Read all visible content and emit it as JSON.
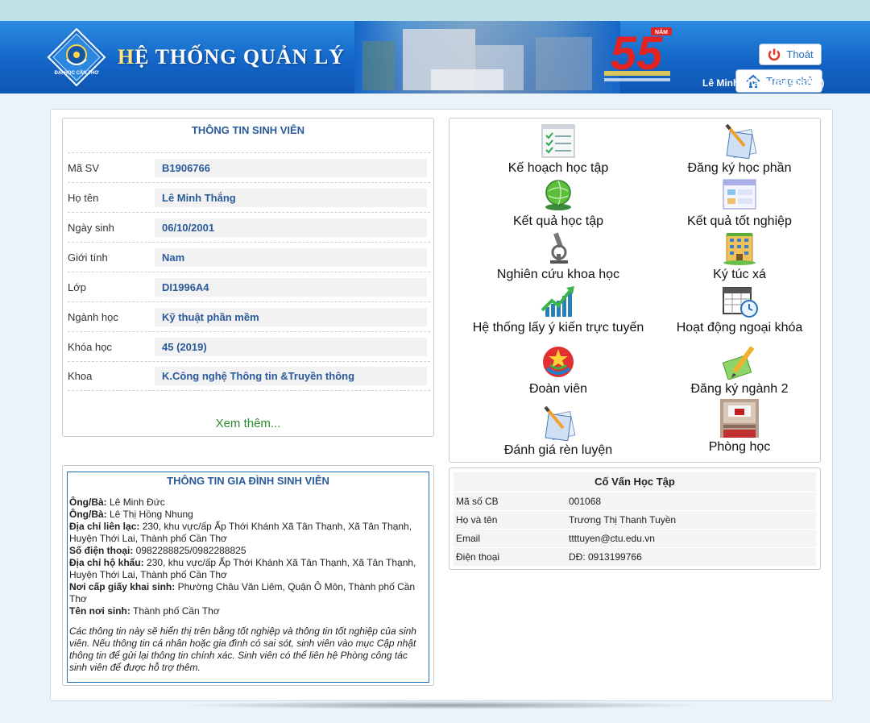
{
  "header": {
    "brand_first": "H",
    "brand_rest": "Ệ THỐNG QUẢN LÝ",
    "logout_label": "Thoát",
    "home_label": "Trang chủ",
    "user_display": "Lê Minh Thắng (B1906766)",
    "badge_number": "55",
    "badge_small": "NĂM",
    "logo_text": "ĐẠI HỌC CẦN THƠ"
  },
  "student_info": {
    "title": "THÔNG TIN SINH VIÊN",
    "rows": [
      {
        "label": "Mã SV",
        "value": "B1906766"
      },
      {
        "label": "Họ tên",
        "value": "Lê Minh Thắng"
      },
      {
        "label": "Ngày sinh",
        "value": "06/10/2001"
      },
      {
        "label": "Giới tính",
        "value": "Nam"
      },
      {
        "label": "Lớp",
        "value": "DI1996A4"
      },
      {
        "label": "Ngành học",
        "value": "Kỹ thuật phần mềm"
      },
      {
        "label": "Khóa học",
        "value": "45 (2019)"
      },
      {
        "label": "Khoa",
        "value": "K.Công nghệ Thông tin &Truyền thông"
      }
    ],
    "more_link": "Xem thêm..."
  },
  "menu": {
    "items": [
      {
        "label": "Kế hoạch học tập",
        "icon": "checklist-icon"
      },
      {
        "label": "Đăng ký học phần",
        "icon": "register-course-icon"
      },
      {
        "label": "Kết quả học tập",
        "icon": "globe-results-icon"
      },
      {
        "label": "Kết quả tốt nghiệp",
        "icon": "window-grid-icon"
      },
      {
        "label": "Nghiên cứu khoa học",
        "icon": "microscope-icon"
      },
      {
        "label": "Ký túc xá",
        "icon": "building-icon"
      },
      {
        "label": "Hệ thống lấy ý kiến trực tuyến",
        "icon": "growth-chart-icon"
      },
      {
        "label": "Hoạt động ngoại khóa",
        "icon": "calendar-clock-icon"
      },
      {
        "label": "Đoàn viên",
        "icon": "youth-union-icon"
      },
      {
        "label": "Đăng ký ngành 2",
        "icon": "pencil-book-icon"
      },
      {
        "label": "Đánh giá rèn luyện",
        "icon": "evaluation-icon"
      },
      {
        "label": "Phòng học",
        "icon": "classroom-icon"
      }
    ]
  },
  "family": {
    "title": "THÔNG TIN GIA ĐÌNH SINH VIÊN",
    "parent1_label": "Ông/Bà:",
    "parent1": " Lê Minh Đức",
    "parent2_label": "Ông/Bà:",
    "parent2": " Lê Thị Hồng Nhung",
    "contact_addr_label": "Địa chỉ liên lạc:",
    "contact_addr": " 230, khu vực/ấp Ấp Thới Khánh Xã Tân Thạnh, Xã Tân Thạnh, Huyện Thới Lai, Thành phố Cần Thơ",
    "phone_label": "Số điện thoại:",
    "phone": " 0982288825/0982288825",
    "home_addr_label": "Địa chỉ hộ khẩu:",
    "home_addr": " 230, khu vực/ấp Ấp Thới Khánh Xã Tân Thạnh, Xã Tân Thạnh, Huyện Thới Lai, Thành phố Cần Thơ",
    "birth_cert_label": "Nơi cấp giấy khai sinh:",
    "birth_cert": " Phường Châu Văn Liêm, Quận Ô Môn, Thành phố Cần Thơ",
    "birthplace_label": "Tên nơi sinh:",
    "birthplace": " Thành phố Cần Thơ",
    "note": "Các thông tin này sẽ hiển thị trên bằng tốt nghiệp và thông tin tốt nghiệp của sinh viên. Nếu thông tin cá nhân hoặc gia đình có sai sót, sinh viên vào mục Cập nhật thông tin để gửi lại thông tin chính xác. Sinh viên có thể liên hệ Phòng công tác sinh viên để được hỗ trợ thêm."
  },
  "advisor": {
    "title": "Cố Vấn Học Tập",
    "rows": [
      {
        "label": "Mã số CB",
        "value": "001068"
      },
      {
        "label": "Họ và tên",
        "value": "Trương Thị Thanh Tuyền"
      },
      {
        "label": "Email",
        "value": "ttttuyen@ctu.edu.vn"
      },
      {
        "label": "Điện thoại",
        "value": "DĐ: 0913199766"
      }
    ]
  },
  "colors": {
    "header_blue": "#1466c8",
    "title_blue": "#2a5a9a",
    "link_green": "#2d8a2d"
  }
}
